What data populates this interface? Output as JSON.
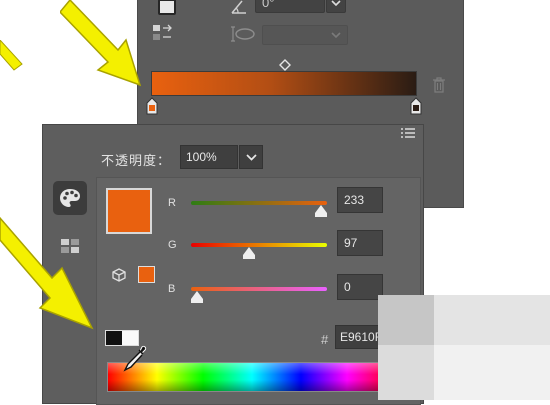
{
  "gradient_panel": {
    "angle_value": "0°",
    "gradient_colors": {
      "start": "#e9610f",
      "mid": "#b24e14",
      "end": "#2a1c14"
    }
  },
  "color_panel": {
    "opacity_label": "不透明度：",
    "opacity_value": "100%",
    "channels": [
      {
        "label": "R",
        "value": "233",
        "level": 0.91
      },
      {
        "label": "G",
        "value": "97",
        "level": 0.38
      },
      {
        "label": "B",
        "value": "0",
        "level": 0.0
      }
    ],
    "hash_label": "#",
    "hex_value": "E9610F",
    "current_color": "#e9610f"
  },
  "colors": {
    "panel_bg": "#5b5b5b",
    "arrow_yellow": "#f4f000",
    "accent_orange": "#e9610f"
  },
  "icons": {
    "palette": "palette-icon",
    "swatches": "swatches-grid-icon",
    "cube": "web-safe-cube-icon",
    "eyedropper": "eyedropper-icon",
    "trash": "trash-icon",
    "menu": "panel-menu-icon"
  }
}
